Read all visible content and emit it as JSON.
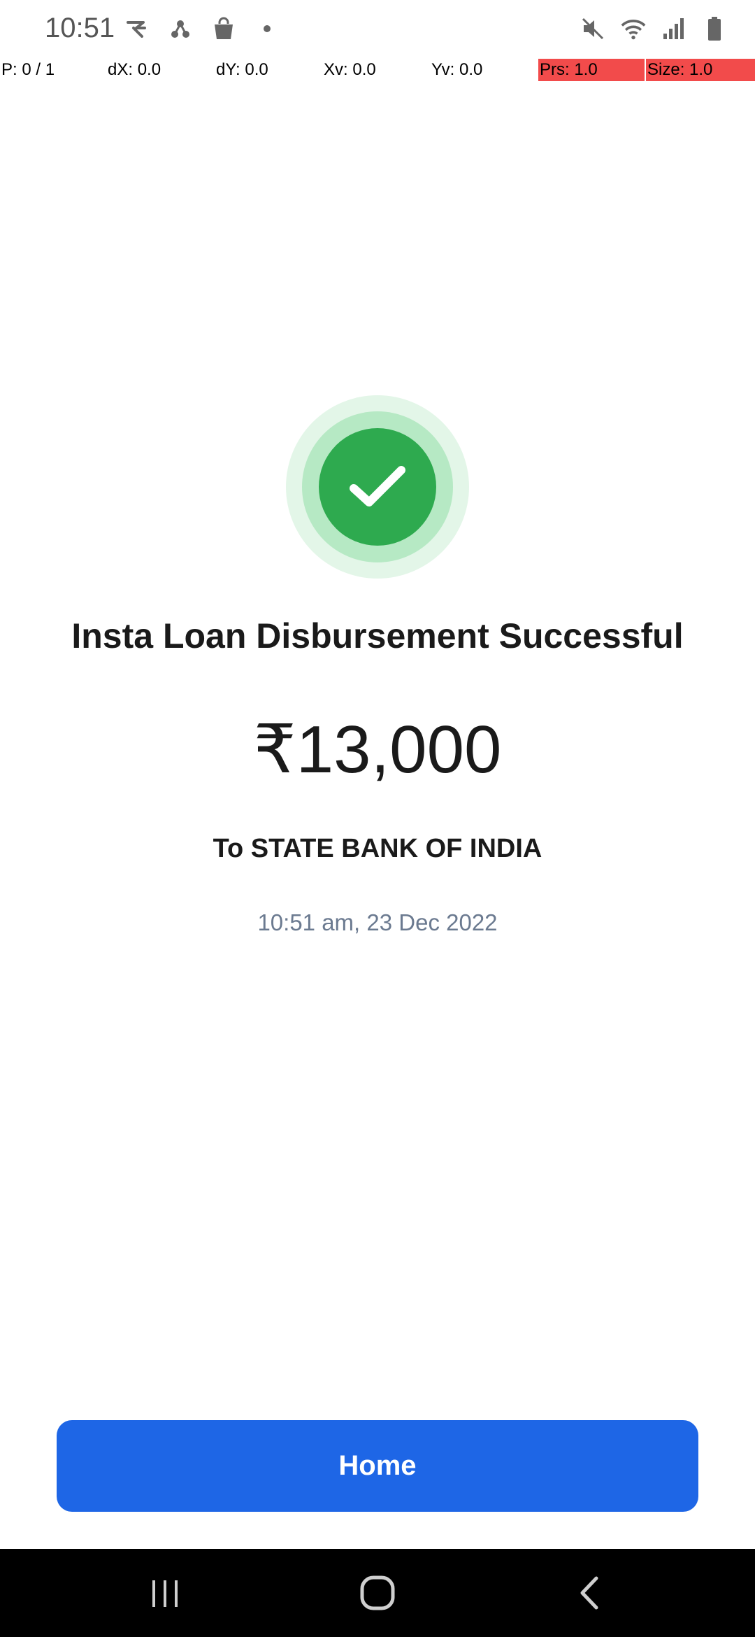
{
  "status_bar": {
    "time": "10:51",
    "left_icons": [
      "rapido-icon",
      "share-nodes-icon",
      "shopping-bag-icon",
      "dot-icon"
    ],
    "right_icons": [
      "mute-icon",
      "wifi-icon",
      "signal-icon",
      "battery-icon"
    ]
  },
  "pointer_overlay": {
    "p": "P: 0 / 1",
    "dx": "dX: 0.0",
    "dy": "dY: 0.0",
    "xv": "Xv: 0.0",
    "yv": "Yv: 0.0",
    "prs": "Prs: 1.0",
    "size": "Size: 1.0"
  },
  "main": {
    "status_icon": "check-circle-icon",
    "title": "Insta Loan Disbursement Successful",
    "amount": "₹13,000",
    "recipient": "To STATE BANK OF INDIA",
    "timestamp": "10:51 am, 23 Dec 2022",
    "home_button_label": "Home"
  },
  "colors": {
    "success_green": "#2eaa4f",
    "primary_blue": "#1e66e6",
    "overlay_red": "#f24b4b"
  },
  "nav_bar": {
    "buttons": [
      "recents-icon",
      "home-icon",
      "back-icon"
    ]
  }
}
